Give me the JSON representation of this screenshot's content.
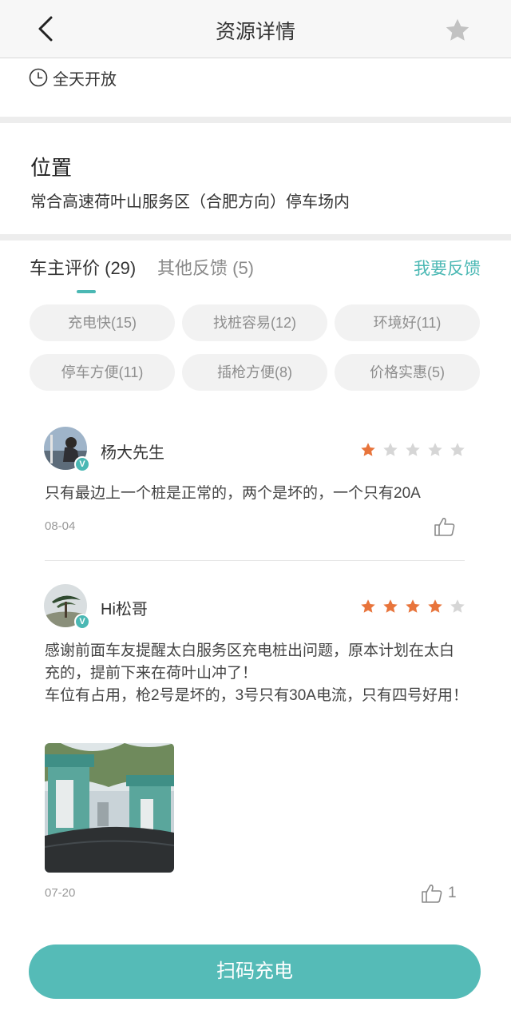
{
  "header": {
    "title": "资源详情",
    "back_icon": "chevron-left-icon",
    "favorite_icon": "star-icon"
  },
  "hours": {
    "icon": "clock-icon",
    "text": "全天开放"
  },
  "location": {
    "title": "位置",
    "address": "常合高速荷叶山服务区（合肥方向）停车场内"
  },
  "tabs": [
    {
      "label": "车主评价 (29)",
      "active": true
    },
    {
      "label": "其他反馈 (5)",
      "active": false
    }
  ],
  "feedback_link": "我要反馈",
  "tags": [
    "充电快(15)",
    "找桩容易(12)",
    "环境好(11)",
    "停车方便(11)",
    "插枪方便(8)",
    "价格实惠(5)"
  ],
  "reviews": [
    {
      "user": "杨大先生",
      "rating": 1,
      "text": "只有最边上一个桩是正常的，两个是坏的，一个只有20A",
      "date": "08-04",
      "likes": ""
    },
    {
      "user": "Hi松哥",
      "rating": 4,
      "text_line1": "感谢前面车友提醒太白服务区充电桩出问题，原本计划在太白充的，提前下来在荷叶山冲了！",
      "text_line2": "车位有占用，枪2号是坏的，3号只有30A电流，只有四号好用！",
      "date": "07-20",
      "likes": "1"
    }
  ],
  "verified_badge": "V",
  "cta": "扫码充电",
  "colors": {
    "accent": "#4bb8b4",
    "star_on": "#e8743b",
    "star_off": "#d6d6d6",
    "cta": "#55bbb7"
  }
}
